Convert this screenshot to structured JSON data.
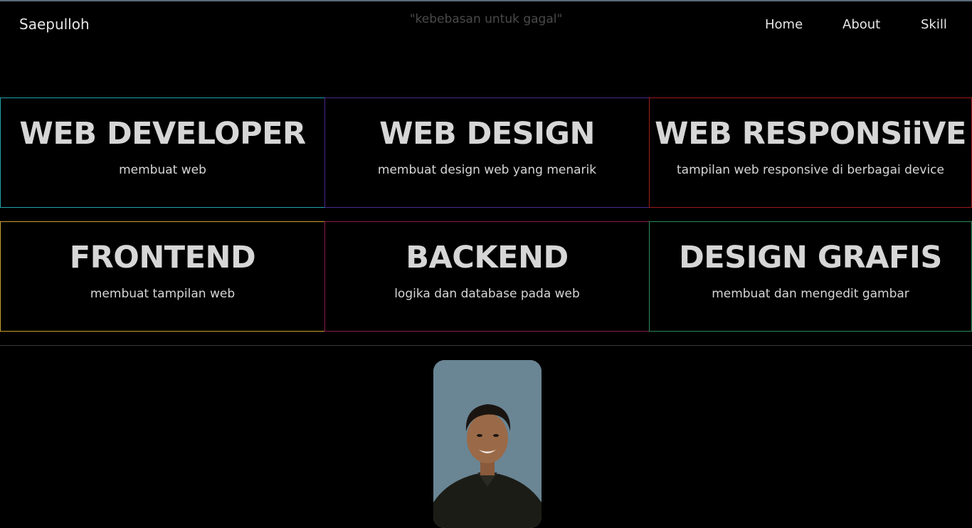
{
  "header": {
    "brand": "Saepulloh",
    "tagline": "\"kebebasan untuk gagal\"",
    "nav": [
      {
        "label": "Home"
      },
      {
        "label": "About"
      },
      {
        "label": "Skill"
      }
    ]
  },
  "skills": [
    {
      "title": "WEB DEVELOPER",
      "desc": "membuat web",
      "border_color": "#1fa2a8"
    },
    {
      "title": "WEB DESIGN",
      "desc": "membuat design web yang menarik",
      "border_color": "#4b2a8f"
    },
    {
      "title": "WEB RESPONSiiVE",
      "desc": "tampilan web responsive di berbagai device",
      "border_color": "#a01a1a"
    },
    {
      "title": "FRONTEND",
      "desc": "membuat tampilan web",
      "border_color": "#c8a030"
    },
    {
      "title": "BACKEND",
      "desc": "logika dan database pada web",
      "border_color": "#8a1a4a"
    },
    {
      "title": "DESIGN GRAFIS",
      "desc": "membuat dan mengedit gambar",
      "border_color": "#2a8a5a"
    }
  ],
  "colors": {
    "background": "#000000",
    "text": "#d6d6d6",
    "tagline": "#4a4a4a",
    "photo_background": "#6a8594"
  },
  "icons": {
    "profile_photo": "person-portrait"
  }
}
